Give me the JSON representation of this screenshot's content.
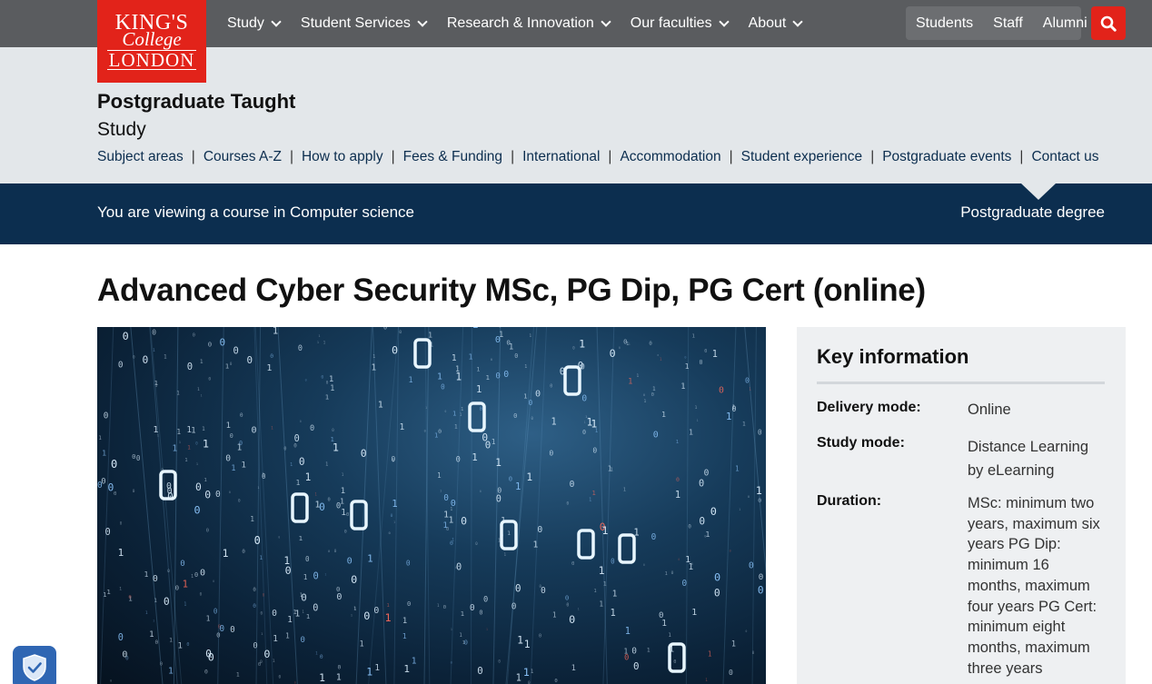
{
  "logo": {
    "line1": "KING'S",
    "line2": "College",
    "line3": "LONDON"
  },
  "nav": [
    {
      "label": "Study"
    },
    {
      "label": "Student Services"
    },
    {
      "label": "Research & Innovation"
    },
    {
      "label": "Our faculties"
    },
    {
      "label": "About"
    }
  ],
  "audience": [
    "Students",
    "Staff",
    "Alumni"
  ],
  "section": {
    "title": "Postgraduate Taught",
    "subtitle": "Study",
    "links": [
      "Subject areas",
      "Courses A-Z",
      "How to apply",
      "Fees & Funding",
      "International",
      "Accommodation",
      "Student experience",
      "Postgraduate events",
      "Contact us"
    ]
  },
  "band": {
    "viewing": "You are viewing a course in Computer science",
    "degree": "Postgraduate degree"
  },
  "course": {
    "title": "Advanced Cyber Security MSc, PG Dip, PG Cert (online)"
  },
  "key_info": {
    "heading": "Key information",
    "rows": [
      {
        "label": "Delivery mode:",
        "value": "Online"
      },
      {
        "label": "Study mode:",
        "value": "Distance Learning by eLearning"
      },
      {
        "label": "Duration:",
        "value": "MSc: minimum two years, maximum six years PG Dip: minimum 16 months, maximum four years PG Cert: minimum eight months, maximum three years"
      }
    ]
  },
  "icons": {
    "chevron": "chevron-down-icon",
    "search": "search-icon",
    "cookie": "shield-check-icon"
  },
  "colors": {
    "brand_red": "#e2231a",
    "navy": "#0c2e4f",
    "topbar": "#5a5c5f"
  }
}
